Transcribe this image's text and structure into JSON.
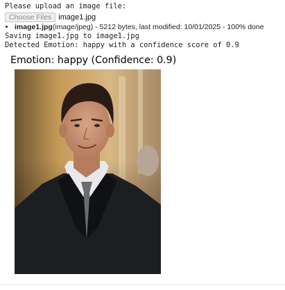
{
  "output": {
    "prompt": "Please upload an image file:",
    "upload": {
      "button_label": "Choose Files",
      "selected_file": "image1.jpg"
    },
    "file_entry": {
      "name": "image1.jpg",
      "details": "(image/jpeg) - 5212 bytes, last modified: 10/01/2025 - 100% done"
    },
    "saving_message": "Saving image1.jpg to image1.jpg",
    "detected_message": "Detected Emotion: happy with a confidence score of 0.9"
  },
  "figure": {
    "title": "Emotion: happy (Confidence: 0.9)"
  },
  "colors": {
    "suit": "#1d1e22",
    "shirt": "#e9e9ec",
    "tie": "#6b6c72",
    "skin": "#c99173",
    "hair": "#2a1c15",
    "background_warm": "#c59a57"
  }
}
